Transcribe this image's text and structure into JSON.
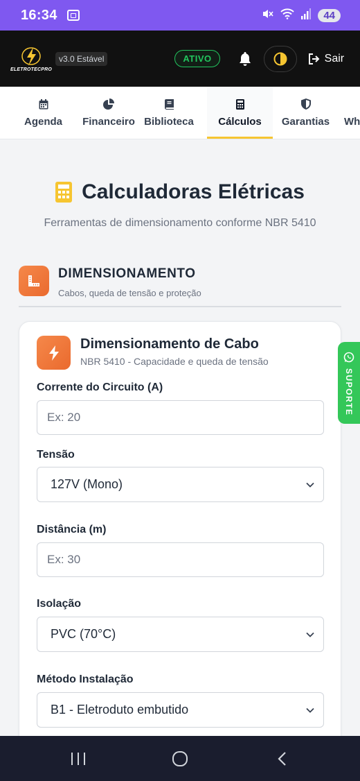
{
  "status_bar": {
    "time": "16:34",
    "battery": "44",
    "mute_icon": "mute-icon",
    "wifi_icon": "wifi-icon",
    "signal_icon": "signal-icon"
  },
  "header": {
    "logo_text": "ELETROTECPRO",
    "version": "v3.0 Estável",
    "status_badge": "ATIVO",
    "logout_label": "Sair"
  },
  "tabs": [
    {
      "label": "Agenda",
      "icon": "calendar-icon",
      "active": false
    },
    {
      "label": "Financeiro",
      "icon": "pie-chart-icon",
      "active": false
    },
    {
      "label": "Biblioteca",
      "icon": "book-icon",
      "active": false
    },
    {
      "label": "Cálculos",
      "icon": "calculator-icon",
      "active": true
    },
    {
      "label": "Garantias",
      "icon": "shield-icon",
      "active": false
    },
    {
      "label": "Wh",
      "icon": "",
      "active": false
    }
  ],
  "page": {
    "title": "Calculadoras Elétricas",
    "subtitle": "Ferramentas de dimensionamento conforme NBR 5410"
  },
  "section": {
    "title": "DIMENSIONAMENTO",
    "subtitle": "Cabos, queda de tensão e proteção"
  },
  "card": {
    "title": "Dimensionamento de Cabo",
    "subtitle": "NBR 5410 - Capacidade e queda de tensão",
    "fields": {
      "corrente": {
        "label": "Corrente do Circuito (A)",
        "placeholder": "Ex: 20",
        "value": ""
      },
      "tensao": {
        "label": "Tensão",
        "selected": "127V (Mono)"
      },
      "distancia": {
        "label": "Distância (m)",
        "placeholder": "Ex: 30",
        "value": ""
      },
      "isolacao": {
        "label": "Isolação",
        "selected": "PVC (70°C)"
      },
      "metodo": {
        "label": "Método Instalação",
        "selected": "B1 - Eletroduto embutido"
      }
    }
  },
  "support": {
    "label": "SUPORTE"
  },
  "colors": {
    "accent": "#f6c531",
    "status_bar": "#7f58f0",
    "header_bg": "#111111",
    "orange": "#ef7a3c",
    "green": "#34c759"
  }
}
